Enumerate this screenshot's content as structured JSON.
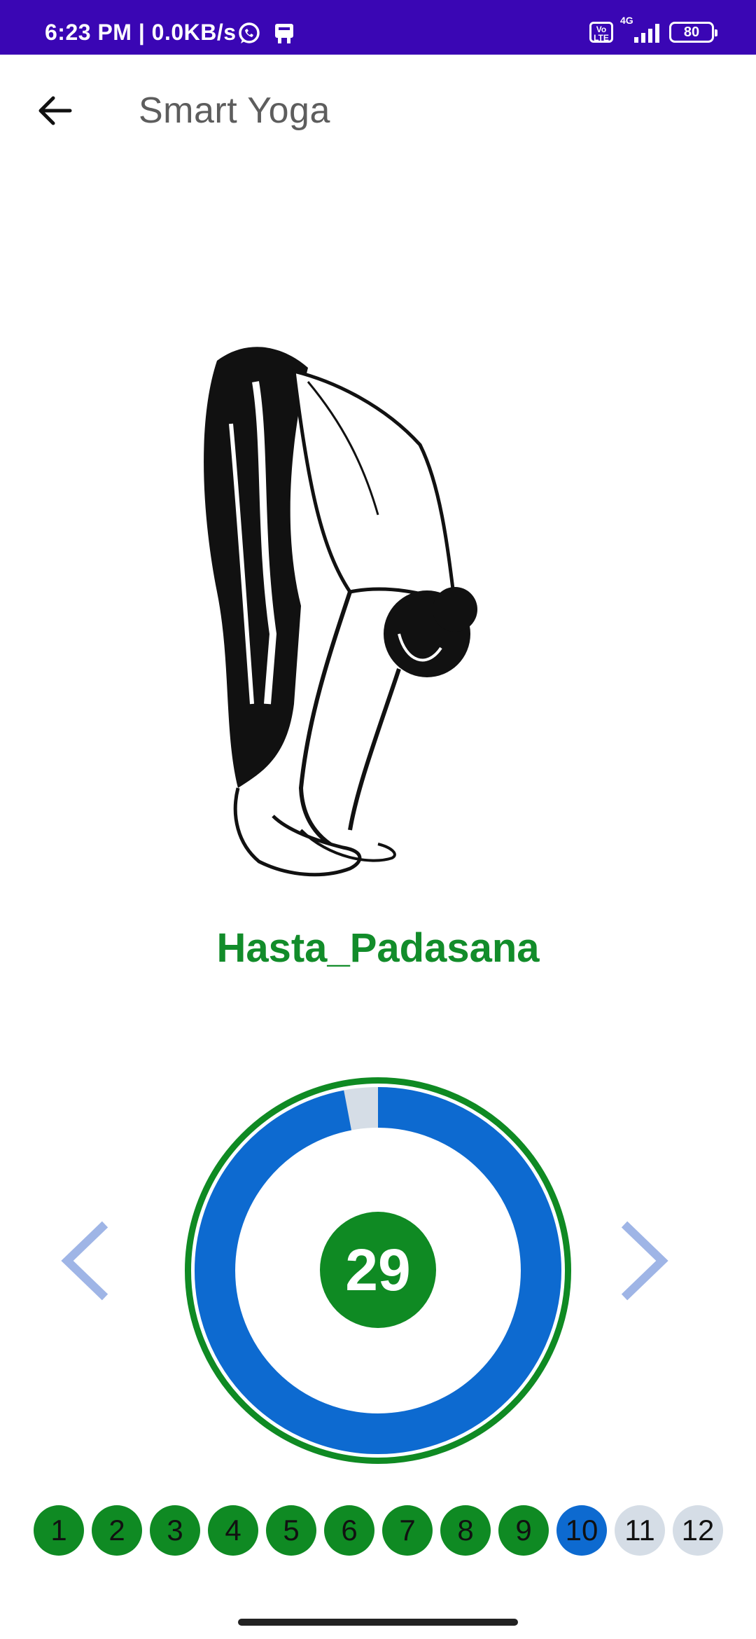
{
  "status_bar": {
    "time_text": "6:23 PM | 0.0KB/s",
    "volte_label": "Vo LTE",
    "network_label": "4G",
    "battery_level": "80"
  },
  "app_bar": {
    "title": "Smart Yoga",
    "back_icon": "arrow-back-icon"
  },
  "pose": {
    "name": "Hasta_Padasana",
    "illustration": "standing-forward-bend-illustration"
  },
  "timer": {
    "remaining_seconds": "29",
    "progress_fraction": 0.97,
    "colors": {
      "outer_ring": "#0f8a23",
      "progress": "#0d6ad0",
      "remaining_track": "#d5dde6",
      "count_badge": "#0f8a23"
    }
  },
  "navigation": {
    "prev_icon": "chevron-left-icon",
    "next_icon": "chevron-right-icon",
    "arrow_color": "#9fb5e6"
  },
  "steps": {
    "current": 10,
    "items": [
      {
        "label": "1",
        "state": "done"
      },
      {
        "label": "2",
        "state": "done"
      },
      {
        "label": "3",
        "state": "done"
      },
      {
        "label": "4",
        "state": "done"
      },
      {
        "label": "5",
        "state": "done"
      },
      {
        "label": "6",
        "state": "done"
      },
      {
        "label": "7",
        "state": "done"
      },
      {
        "label": "8",
        "state": "done"
      },
      {
        "label": "9",
        "state": "done"
      },
      {
        "label": "10",
        "state": "current"
      },
      {
        "label": "11",
        "state": "todo"
      },
      {
        "label": "12",
        "state": "todo"
      }
    ]
  },
  "theme": {
    "status_bar_color": "#3a06b4",
    "accent_green": "#128c2a"
  }
}
